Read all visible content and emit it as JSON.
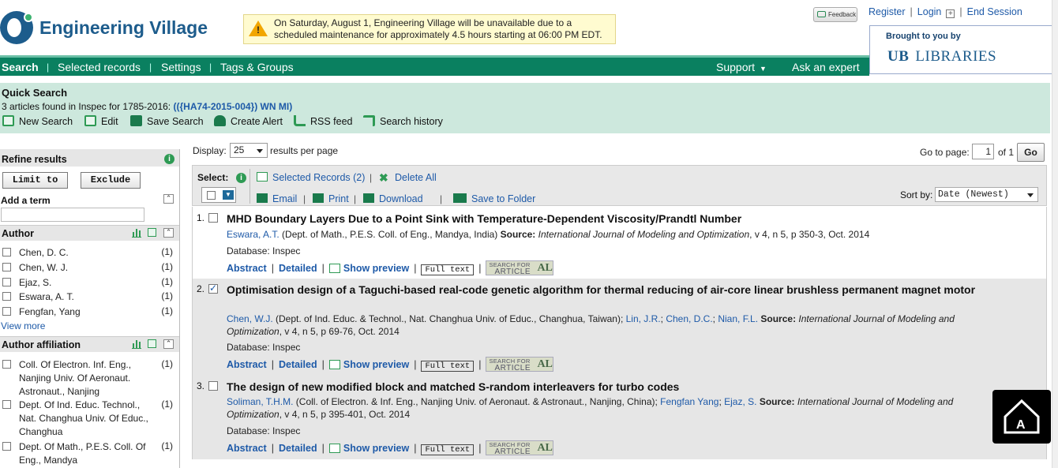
{
  "header": {
    "logo_text": "Engineering Village",
    "notice": "On Saturday, August 1, Engineering Village will be unavailable due to a scheduled maintenance for approximately 4.5 hours starting at 06:00 PM EDT.",
    "feedback": "Feedback",
    "register": "Register",
    "login": "Login",
    "end_session": "End Session",
    "brought_by": "Brought to you by",
    "library_mark": "UB",
    "library_name": "LIBRARIES"
  },
  "nav": {
    "search": "Search",
    "selected_records": "Selected records",
    "settings": "Settings",
    "tags_groups": "Tags & Groups",
    "support": "Support",
    "ask_expert": "Ask an expert"
  },
  "quick_search": {
    "title": "Quick Search",
    "found_prefix": "3 articles found in Inspec for 1785-2016: ",
    "query": "(({HA74-2015-004}) WN MI)",
    "actions": [
      "New Search",
      "Edit",
      "Save Search",
      "Create Alert",
      "RSS feed",
      "Search history"
    ]
  },
  "refine": {
    "title": "Refine results",
    "limit_to": "Limit to",
    "exclude": "Exclude",
    "add_term_label": "Add a term",
    "add_term_value": "",
    "author_title": "Author",
    "authors": [
      {
        "name": "Chen, D. C.",
        "count": "(1)"
      },
      {
        "name": "Chen, W. J.",
        "count": "(1)"
      },
      {
        "name": "Ejaz, S.",
        "count": "(1)"
      },
      {
        "name": "Eswara, A. T.",
        "count": "(1)"
      },
      {
        "name": "Fengfan, Yang",
        "count": "(1)"
      }
    ],
    "view_more": "View more",
    "affiliation_title": "Author affiliation",
    "affiliations": [
      {
        "name": "Coll. Of Electron. Inf. Eng., Nanjing Univ. Of Aeronaut. Astronaut., Nanjing",
        "count": "(1)"
      },
      {
        "name": "Dept. Of Ind. Educ. Technol., Nat. Changhua Univ. Of Educ., Changhua",
        "count": "(1)"
      },
      {
        "name": "Dept. Of Math., P.E.S. Coll. Of Eng., Mandya",
        "count": "(1)"
      }
    ]
  },
  "results_bar": {
    "display_label": "Display:",
    "display_value": "25",
    "per_page": "results per page",
    "goto_label": "Go to page:",
    "page_value": "1",
    "of_pages": "of 1",
    "go": "Go",
    "select_label": "Select:",
    "selected_records": "Selected Records (2)",
    "delete_all": "Delete All",
    "email": "Email",
    "print": "Print",
    "download": "Download",
    "save_folder": "Save to Folder",
    "sort_label": "Sort by:",
    "sort_value": "Date (Newest)"
  },
  "results": [
    {
      "num": "1.",
      "checked": false,
      "title": "MHD Boundary Layers Due to a Point Sink with Temperature-Dependent Viscosity/Prandtl Number",
      "authors": "Eswara, A.T.",
      "affil": " (Dept. of Math., P.E.S. Coll. of Eng., Mandya, India) ",
      "source_label": "Source:",
      "journal": "International Journal of Modeling and Optimization",
      "details": ", v 4, n 5, p 350-3, Oct. 2014",
      "database": "Database: Inspec"
    },
    {
      "num": "2.",
      "checked": true,
      "title": "Optimisation design of a Taguchi-based real-code genetic algorithm for thermal reducing of air-core linear brushless permanent magnet motor",
      "authors": "Chen, W.J.",
      "affil": " (Dept. of Ind. Educ. & Technol., Nat. Changhua Univ. of Educ., Changhua, Taiwan); ",
      "authors2": "Lin, J.R.",
      "sep2": "; ",
      "authors3": "Chen, D.C.",
      "sep3": "; ",
      "authors4": "Nian, F.L.",
      "source_label": "Source:",
      "journal": "International Journal of Modeling and Optimization",
      "details": ", v 4, n 5, p 69-76, Oct. 2014",
      "database": "Database: Inspec"
    },
    {
      "num": "3.",
      "checked": false,
      "title": "The design of new modified block and matched S-random interleavers for turbo codes",
      "authors": "Soliman, T.H.M.",
      "affil": " (Coll. of Electron. & Inf. Eng., Nanjing Univ. of Aeronaut. & Astronaut., Nanjing, China); ",
      "authors2": "Fengfan Yang",
      "sep2": "; ",
      "authors3": "Ejaz, S.",
      "source_label": "Source:",
      "journal": "International Journal of Modeling and Optimization",
      "details": ", v 4, n 5, p 395-401, Oct. 2014",
      "database": "Database: Inspec"
    }
  ],
  "result_links": {
    "abstract": "Abstract",
    "detailed": "Detailed",
    "show_preview": "Show preview",
    "full_text": "Full text",
    "sfa_top": "SEARCH FOR",
    "sfa_bottom": "ARTICLE",
    "sfa_mark": "AL"
  },
  "colors": {
    "nav_green": "#0a8060",
    "quick_search_bg": "#cde8dd",
    "link_blue": "#1e5aa8",
    "logo_blue": "#1d5c8c"
  }
}
